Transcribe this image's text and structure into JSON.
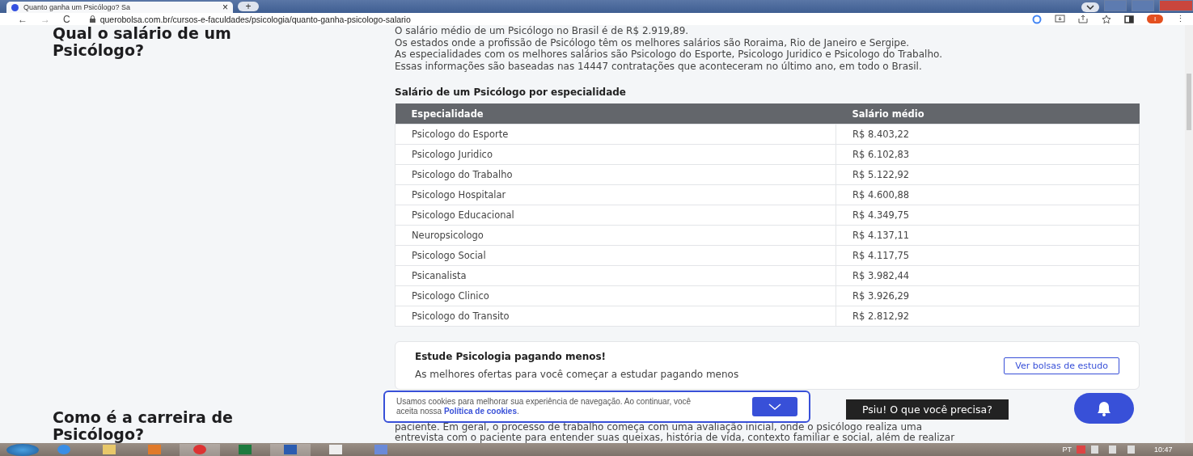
{
  "browser": {
    "tab_title": "Quanto ganha um Psicólogo? Sa",
    "tab_close": "×",
    "new_tab": "+",
    "url": "querobolsa.com.br/cursos-e-faculdades/psicologia/quanto-ganha-psicologo-salario",
    "profile_initial": "I",
    "back": "←",
    "forward": "→",
    "reload": "C",
    "menu": "⋮"
  },
  "section1": {
    "heading": "Qual o salário de um Psicólogo?",
    "paragraph": [
      "O salário médio de um Psicólogo no Brasil é de R$ 2.919,89.",
      "Os estados onde a profissão de Psicólogo têm os melhores salários são Roraima, Rio de Janeiro e Sergipe.",
      "As especialidades com os melhores salários são Psicologo do Esporte, Psicologo Juridico e Psicologo do Trabalho.",
      "Essas informações são baseadas nas 14447 contratações que aconteceram no último ano, em todo o Brasil."
    ],
    "table_title": "Salário de um Psicólogo por especialidade",
    "table": {
      "columns": [
        "Especialidade",
        "Salário médio"
      ],
      "rows": [
        [
          "Psicologo do Esporte",
          "R$ 8.403,22"
        ],
        [
          "Psicologo Juridico",
          "R$ 6.102,83"
        ],
        [
          "Psicologo do Trabalho",
          "R$ 5.122,92"
        ],
        [
          "Psicologo Hospitalar",
          "R$ 4.600,88"
        ],
        [
          "Psicologo Educacional",
          "R$ 4.349,75"
        ],
        [
          "Neuropsicologo",
          "R$ 4.137,11"
        ],
        [
          "Psicologo Social",
          "R$ 4.117,75"
        ],
        [
          "Psicanalista",
          "R$ 3.982,44"
        ],
        [
          "Psicologo Clinico",
          "R$ 3.926,29"
        ],
        [
          "Psicologo do Transito",
          "R$ 2.812,92"
        ]
      ]
    },
    "promo": {
      "title": "Estude Psicologia pagando menos!",
      "text": "As melhores ofertas para você começar a estudar pagando menos",
      "button": "Ver bolsas de estudo"
    }
  },
  "section2": {
    "heading": "Como é a carreira de Psicólogo?",
    "lines": [
      "paciente. Em geral, o processo de trabalho começa com uma avaliação inicial, onde o psicólogo realiza uma",
      "entrevista com o paciente para entender suas queixas, história de vida, contexto familiar e social, além de realizar"
    ]
  },
  "cookie": {
    "text": "Usamos cookies para melhorar sua experiência de navegação. Ao continuar, você aceita nossa",
    "link": "Política de cookies",
    "end": "."
  },
  "help": {
    "tooltip": "Psiu! O que você precisa?"
  },
  "taskbar": {
    "language": "PT",
    "time": "10:47"
  }
}
